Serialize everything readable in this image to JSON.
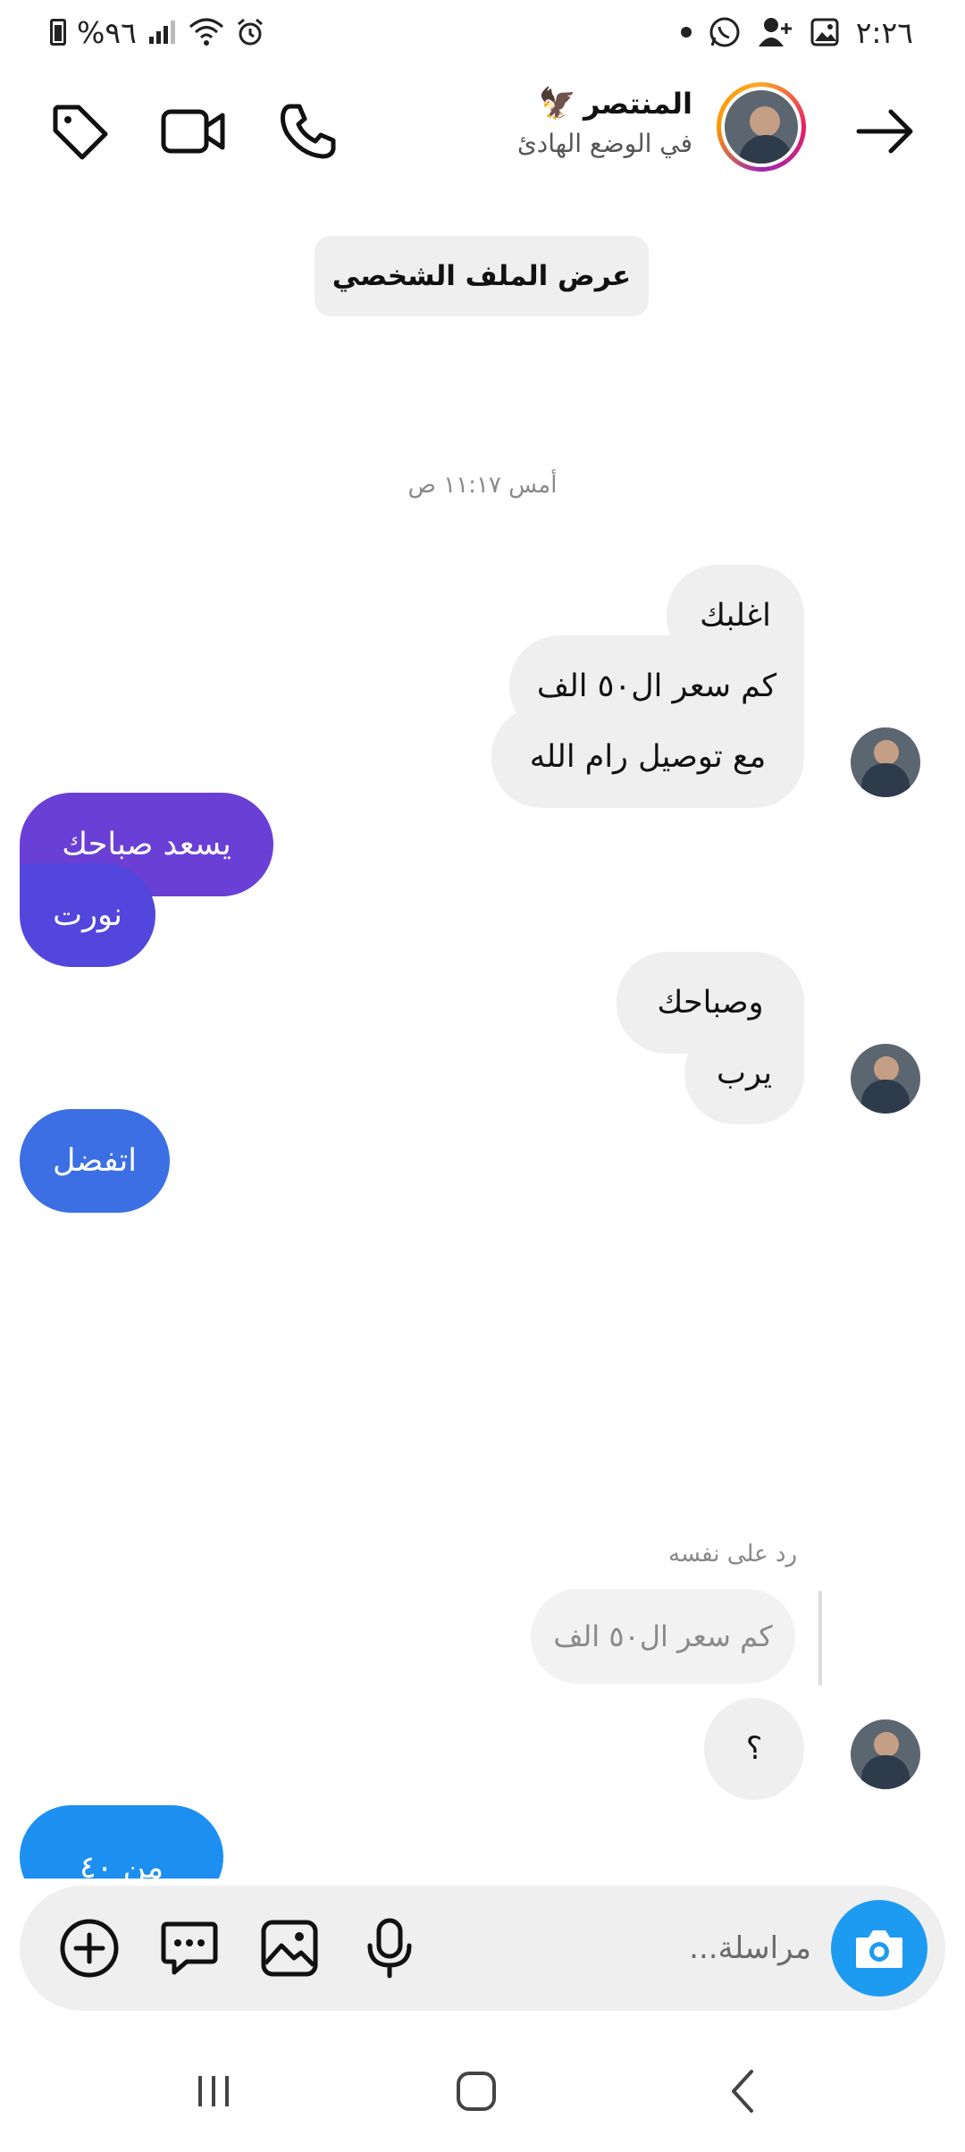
{
  "status_bar": {
    "time": "٢:٢٦",
    "battery": "%٩٦"
  },
  "header": {
    "name": "المنتصر",
    "name_emoji": "🦅",
    "status": "في الوضع الهادئ"
  },
  "conversation": {
    "view_profile_label": "عرض الملف الشخصي",
    "timestamp": "أمس ١١:١٧ ص",
    "messages": [
      {
        "from": "them",
        "text": "اغلبك"
      },
      {
        "from": "them",
        "text": "كم سعر ال٥٠ الف"
      },
      {
        "from": "them",
        "text": "مع توصيل رام الله"
      },
      {
        "from": "me",
        "text": "يسعد صباحك"
      },
      {
        "from": "me",
        "text": "نورت"
      },
      {
        "from": "them",
        "text": "وصباحك"
      },
      {
        "from": "them",
        "text": "يرب"
      },
      {
        "from": "me",
        "text": "اتفضل"
      },
      {
        "from": "them",
        "text": "؟"
      },
      {
        "from": "me",
        "text": "من ٤٠"
      }
    ],
    "reply_label": "رد على نفسه",
    "reply_quote": "كم سعر ال٥٠ الف"
  },
  "composer": {
    "placeholder": "مراسلة..."
  },
  "colors": {
    "bubble_in": "#efefef",
    "bubble_out_purple": "#6a3fd6",
    "bubble_out_indigo": "#5246dc",
    "bubble_out_blue": "#3b6fe3",
    "bubble_out_azure": "#1d8ff0",
    "camera": "#1d9bf0"
  }
}
